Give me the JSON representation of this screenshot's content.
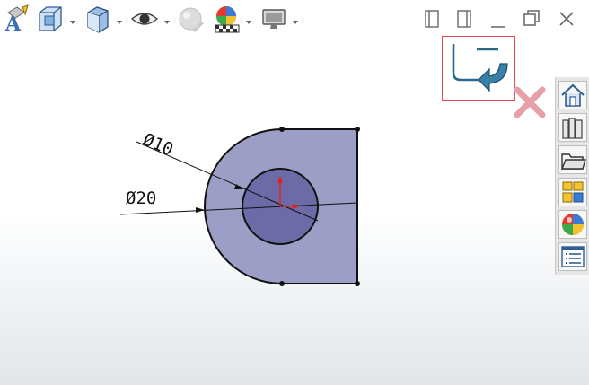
{
  "toolbar": {
    "items": [
      {
        "name": "view-orientation-icon"
      },
      {
        "name": "section-view-icon"
      },
      {
        "name": "display-style-icon"
      },
      {
        "name": "hide-show-items-icon"
      },
      {
        "name": "edit-appearance-icon"
      },
      {
        "name": "apply-scene-icon"
      },
      {
        "name": "view-settings-icon"
      }
    ]
  },
  "window_controls": [
    "tile-left-icon",
    "tile-right-icon",
    "minimize-icon",
    "restore-icon",
    "close-icon"
  ],
  "sketch": {
    "dimensions": [
      {
        "label": "Ø10"
      },
      {
        "label": "Ø20"
      }
    ]
  },
  "confirm_corner": {
    "accept": "exit-sketch-icon",
    "cancel": "cancel-icon"
  },
  "task_pane": [
    "home-icon",
    "design-library-icon",
    "file-explorer-icon",
    "view-palette-icon",
    "appearances-icon",
    "custom-properties-icon"
  ],
  "colors": {
    "face": "#9d9ec6",
    "hole": "#6c6ba8",
    "outline": "#111111",
    "confirm_border": "#e74a53",
    "cancel": "#e8a0a8"
  }
}
